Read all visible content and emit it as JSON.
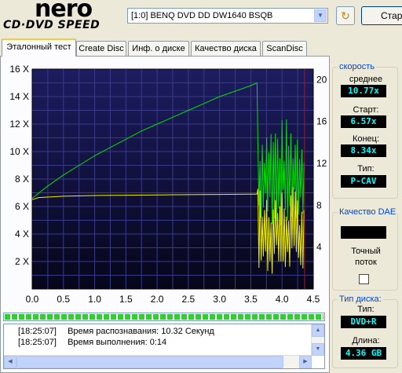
{
  "logo": {
    "brand": "nero",
    "product": "CD·DVD SPEED"
  },
  "toolbar": {
    "drive_select": "[1:0]  BENQ DVD DD DW1640 BSQB",
    "start_label": "Старт"
  },
  "tabs": [
    {
      "label": "Эталонный тест",
      "active": true
    },
    {
      "label": "Create Disc"
    },
    {
      "label": "Инф. о диске"
    },
    {
      "label": "Качество диска"
    },
    {
      "label": "ScanDisc"
    }
  ],
  "chart_data": {
    "type": "line",
    "x_ticks": [
      "0.0",
      "0.5",
      "1.0",
      "1.5",
      "2.0",
      "2.5",
      "3.0",
      "3.5",
      "4.0",
      "4.5"
    ],
    "y_left_ticks": [
      "2 X",
      "4 X",
      "6 X",
      "8 X",
      "10 X",
      "12 X",
      "14 X",
      "16 X"
    ],
    "y_right_ticks": [
      "4",
      "8",
      "12",
      "16",
      "20"
    ],
    "xlim": [
      0,
      4.5
    ],
    "ylim_left": [
      0,
      16
    ],
    "ylim_right": [
      0,
      21
    ],
    "marker_x": 4.36,
    "series": [
      {
        "color": "#00e000",
        "x": [
          0,
          0.25,
          0.5,
          0.75,
          1.0,
          1.25,
          1.5,
          1.75,
          2.0,
          2.25,
          2.5,
          2.75,
          3.0,
          3.25,
          3.5,
          3.6
        ],
        "y": [
          6.6,
          7.5,
          8.3,
          9.0,
          9.7,
          10.3,
          10.9,
          11.5,
          12.0,
          12.5,
          13.0,
          13.5,
          14.0,
          14.4,
          14.8,
          15.0
        ]
      },
      {
        "color": "#f0f000",
        "x": [
          0,
          0.1,
          0.5,
          1.0,
          1.5,
          2.0,
          2.5,
          3.0,
          3.5,
          3.6
        ],
        "y": [
          6.5,
          6.65,
          6.75,
          6.8,
          6.82,
          6.84,
          6.86,
          6.88,
          6.9,
          6.9
        ]
      }
    ],
    "noisy_region": {
      "x_start": 3.6,
      "x_end": 4.36,
      "green_range": [
        4.5,
        12.5
      ],
      "yellow_range": [
        1.0,
        7.5
      ]
    }
  },
  "progress": {
    "fraction": 1.0,
    "color": "#33cc33"
  },
  "log": [
    {
      "time": "[18:25:07]",
      "text": "Время распознавания: 10.32 Секунд"
    },
    {
      "time": "[18:25:07]",
      "text": "Время выполнения: 0:14"
    }
  ],
  "speed_panel": {
    "title": "скорость",
    "avg_label": "среднее",
    "avg_value": "10.77x",
    "start_label": "Старт:",
    "start_value": "6.57x",
    "end_label": "Конец:",
    "end_value": "8.34x",
    "type_label": "Тип:",
    "type_value": "P-CAV"
  },
  "dae_panel": {
    "title": "Качество DAE",
    "value": "",
    "accurate_label_1": "Точный",
    "accurate_label_2": "поток",
    "accurate_checked": false
  },
  "disc_panel": {
    "title": "Тип диска:",
    "type_label": "Тип:",
    "type_value": "DVD+R",
    "length_label": "Длина:",
    "length_value": "4.36 GB"
  }
}
